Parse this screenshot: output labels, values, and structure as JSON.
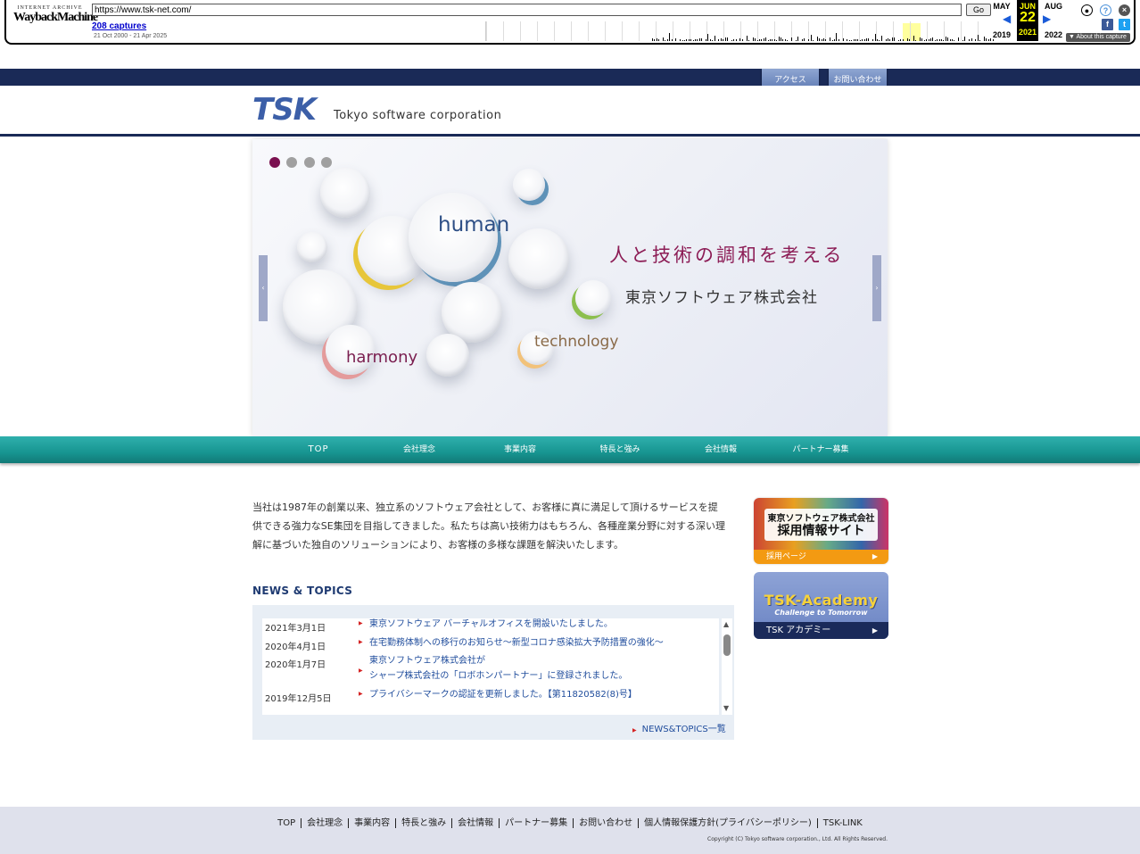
{
  "wayback": {
    "logo_top": "INTERNET ARCHIVE",
    "logo_main_a": "Wayback",
    "logo_main_b": "Machine",
    "url": "https://www.tsk-net.com/",
    "go": "Go",
    "captures": "208 captures",
    "range": "21 Oct 2000 - 21 Apr 2025",
    "prev_month": "MAY",
    "cur_month": "JUN",
    "next_month": "AUG",
    "prev_year": "2019",
    "cur_day": "22",
    "cur_year": "2021",
    "next_year": "2022",
    "about": "▼ About this capture"
  },
  "top_buttons": {
    "access": "アクセス",
    "contact": "お問い合わせ"
  },
  "header": {
    "logo": "TSK",
    "tagline": "Tokyo software corporation"
  },
  "hero": {
    "word_human": "human",
    "word_harmony": "harmony",
    "word_technology": "technology",
    "catch": "人と技術の調和を考える",
    "company": "東京ソフトウェア株式会社",
    "prev": "‹",
    "next": "›"
  },
  "nav": [
    "TOP",
    "会社理念",
    "事業内容",
    "特長と強み",
    "会社情報",
    "パートナー募集"
  ],
  "intro": "当社は1987年の創業以来、独立系のソフトウェア会社として、お客様に真に満足して頂けるサービスを提供できる強力なSE集団を目指してきました。私たちは高い技術力はもちろん、各種産業分野に対する深い理解に基づいた独自のソリューションにより、お客様の多様な課題を解決いたします。",
  "news": {
    "title": "NEWS & TOPICS",
    "items": [
      {
        "date": "2021年3月1日",
        "text": "東京ソフトウェア バーチャルオフィスを開設いたしました。"
      },
      {
        "date": "2020年4月1日",
        "text": "在宅勤務体制への移行のお知らせ～新型コロナ感染拡大予防措置の強化～"
      },
      {
        "date": "2020年1月7日",
        "text": "東京ソフトウェア株式会社が",
        "text2": "シャープ株式会社の「ロボホンパートナー」に登録されました。"
      },
      {
        "date": "2019年12月5日",
        "text": "プライバシーマークの認証を更新しました。【第11820582(8)号】"
      }
    ],
    "more": "NEWS&TOPICS一覧"
  },
  "banners": {
    "recruit_line1": "東京ソフトウェア株式会社",
    "recruit_line2": "採用情報サイト",
    "recruit_link": "採用ページ",
    "academy_title": "TSK-Academy",
    "academy_sub": "Challenge to Tomorrow",
    "academy_link": "TSK アカデミー",
    "arrow": "▶"
  },
  "footer": {
    "links": [
      "TOP",
      "会社理念",
      "事業内容",
      "特長と強み",
      "会社情報",
      "パートナー募集",
      "お問い合わせ",
      "個人情報保護方針(プライバシーポリシー)",
      "TSK-LINK"
    ],
    "copyright": "Copyright (C) Tokyo software corporation., Ltd. All Rights Reserved."
  },
  "colors": {
    "navy": "#1a2a57",
    "teal": "#179591",
    "catch": "#8c1c55",
    "link": "#1f4c9c"
  }
}
